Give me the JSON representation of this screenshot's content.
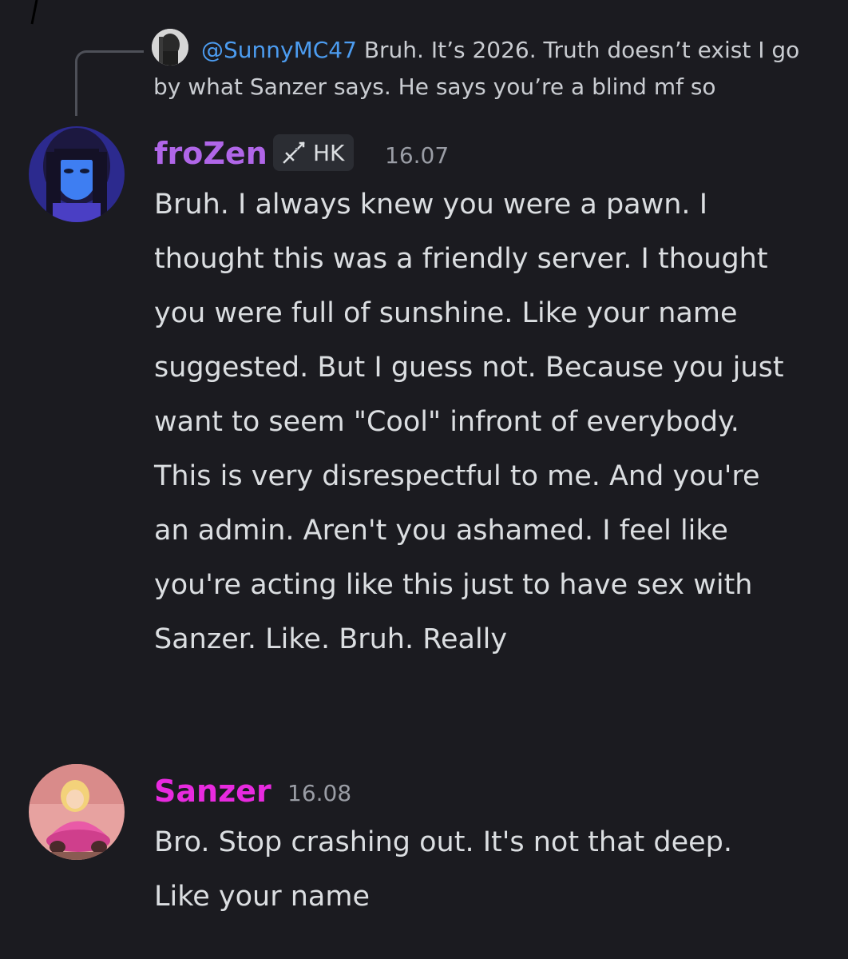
{
  "reply": {
    "mention": "@SunnyMC47",
    "text": "Bruh. It’s 2026. Truth doesn’t exist I go by what Sanzer says. He says you’re a blind mf so"
  },
  "messages": [
    {
      "username": "froZen",
      "username_color": "#b066e8",
      "role_tag": {
        "icon": "sword-icon",
        "label": "HK"
      },
      "timestamp": "16.07",
      "text": "Bruh. I always knew you were a pawn. I thought this was a friendly server. I thought you were full of sunshine. Like your name suggested. But I guess not. Because you just want to seem \"Cool\" infront of everybody. This is very disrespectful to me. And you're an admin. Aren't you ashamed. I feel like you're acting like this just to have sex with Sanzer. Like. Bruh. Really"
    },
    {
      "username": "Sanzer",
      "username_color": "#e82adf",
      "timestamp": "16.08",
      "text": "Bro. Stop crashing out. It's not that deep. Like your name"
    }
  ],
  "colors": {
    "background": "#1b1b20",
    "mention": "#4c9cf0",
    "reply_line": "#4e5058",
    "timestamp": "#9a9da5"
  }
}
